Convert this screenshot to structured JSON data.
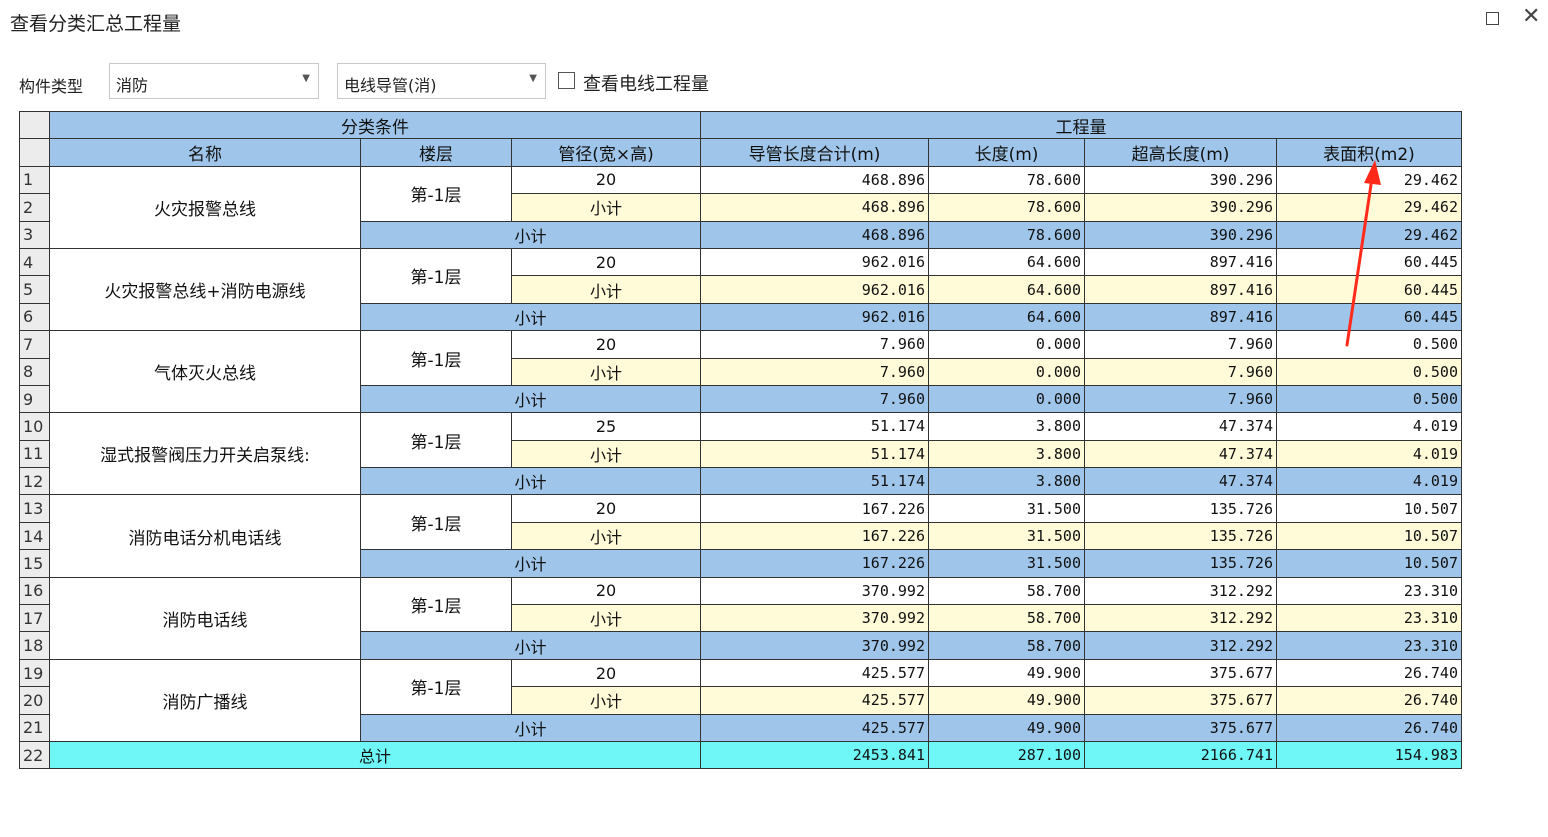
{
  "window": {
    "title": "查看分类汇总工程量"
  },
  "filters": {
    "component_type_label": "构件类型",
    "component_type_value": "消防",
    "subtype_value": "电线导管(消)",
    "checkbox_label": "查看电线工程量",
    "checkbox_checked": false
  },
  "table": {
    "group_headers": {
      "classification": "分类条件",
      "quantity": "工程量"
    },
    "columns": [
      "名称",
      "楼层",
      "管径(宽×高)",
      "导管长度合计(m)",
      "长度(m)",
      "超高长度(m)",
      "表面积(m2)"
    ],
    "groups": [
      {
        "name": "火灾报警总线",
        "floor": "第-1层",
        "diameter": "20",
        "sub_label": "小计",
        "group_label": "小计",
        "rows": [
          {
            "rn": "1",
            "values": [
              "468.896",
              "78.600",
              "390.296",
              "29.462"
            ]
          },
          {
            "rn": "2",
            "values": [
              "468.896",
              "78.600",
              "390.296",
              "29.462"
            ]
          },
          {
            "rn": "3",
            "values": [
              "468.896",
              "78.600",
              "390.296",
              "29.462"
            ]
          }
        ]
      },
      {
        "name": "火灾报警总线+消防电源线",
        "floor": "第-1层",
        "diameter": "20",
        "sub_label": "小计",
        "group_label": "小计",
        "rows": [
          {
            "rn": "4",
            "values": [
              "962.016",
              "64.600",
              "897.416",
              "60.445"
            ]
          },
          {
            "rn": "5",
            "values": [
              "962.016",
              "64.600",
              "897.416",
              "60.445"
            ]
          },
          {
            "rn": "6",
            "values": [
              "962.016",
              "64.600",
              "897.416",
              "60.445"
            ]
          }
        ]
      },
      {
        "name": "气体灭火总线",
        "floor": "第-1层",
        "diameter": "20",
        "sub_label": "小计",
        "group_label": "小计",
        "rows": [
          {
            "rn": "7",
            "values": [
              "7.960",
              "0.000",
              "7.960",
              "0.500"
            ]
          },
          {
            "rn": "8",
            "values": [
              "7.960",
              "0.000",
              "7.960",
              "0.500"
            ]
          },
          {
            "rn": "9",
            "values": [
              "7.960",
              "0.000",
              "7.960",
              "0.500"
            ]
          }
        ]
      },
      {
        "name": "湿式报警阀压力开关启泵线:",
        "floor": "第-1层",
        "diameter": "25",
        "sub_label": "小计",
        "group_label": "小计",
        "rows": [
          {
            "rn": "10",
            "values": [
              "51.174",
              "3.800",
              "47.374",
              "4.019"
            ]
          },
          {
            "rn": "11",
            "values": [
              "51.174",
              "3.800",
              "47.374",
              "4.019"
            ]
          },
          {
            "rn": "12",
            "values": [
              "51.174",
              "3.800",
              "47.374",
              "4.019"
            ]
          }
        ]
      },
      {
        "name": "消防电话分机电话线",
        "floor": "第-1层",
        "diameter": "20",
        "sub_label": "小计",
        "group_label": "小计",
        "rows": [
          {
            "rn": "13",
            "values": [
              "167.226",
              "31.500",
              "135.726",
              "10.507"
            ]
          },
          {
            "rn": "14",
            "values": [
              "167.226",
              "31.500",
              "135.726",
              "10.507"
            ]
          },
          {
            "rn": "15",
            "values": [
              "167.226",
              "31.500",
              "135.726",
              "10.507"
            ]
          }
        ]
      },
      {
        "name": "消防电话线",
        "floor": "第-1层",
        "diameter": "20",
        "sub_label": "小计",
        "group_label": "小计",
        "rows": [
          {
            "rn": "16",
            "values": [
              "370.992",
              "58.700",
              "312.292",
              "23.310"
            ]
          },
          {
            "rn": "17",
            "values": [
              "370.992",
              "58.700",
              "312.292",
              "23.310"
            ]
          },
          {
            "rn": "18",
            "values": [
              "370.992",
              "58.700",
              "312.292",
              "23.310"
            ]
          }
        ]
      },
      {
        "name": "消防广播线",
        "floor": "第-1层",
        "diameter": "20",
        "sub_label": "小计",
        "group_label": "小计",
        "rows": [
          {
            "rn": "19",
            "values": [
              "425.577",
              "49.900",
              "375.677",
              "26.740"
            ]
          },
          {
            "rn": "20",
            "values": [
              "425.577",
              "49.900",
              "375.677",
              "26.740"
            ]
          },
          {
            "rn": "21",
            "values": [
              "425.577",
              "49.900",
              "375.677",
              "26.740"
            ]
          }
        ]
      }
    ],
    "total": {
      "rn": "22",
      "label": "总计",
      "values": [
        "2453.841",
        "287.100",
        "2166.741",
        "154.983"
      ]
    }
  },
  "annotation": {
    "arrow_color": "#ff2a1a"
  }
}
